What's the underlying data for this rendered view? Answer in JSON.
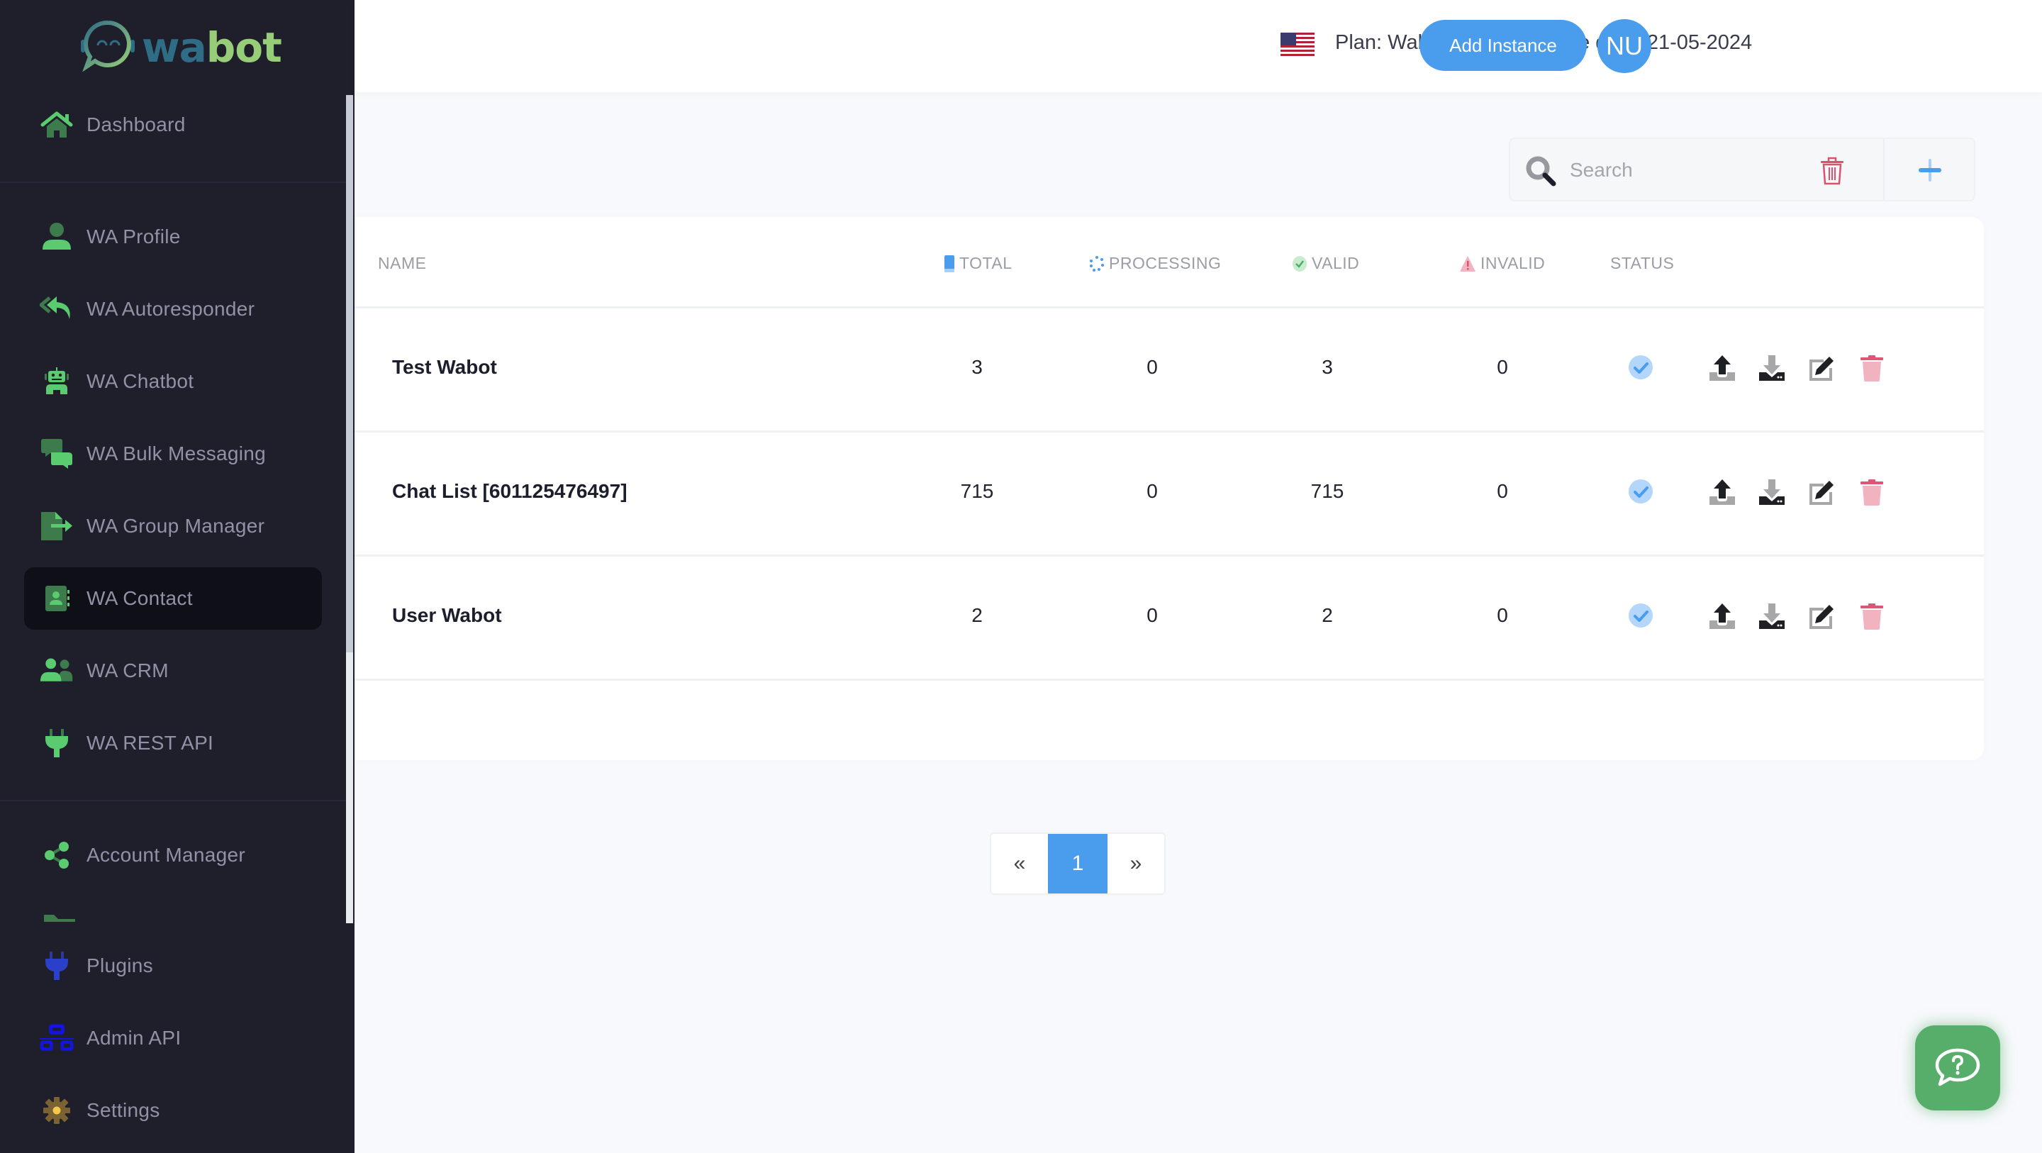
{
  "brand": {
    "logo_wa": "wa",
    "logo_bot": "bot"
  },
  "sidebar": {
    "items": [
      {
        "label": "Dashboard",
        "icon": "home-icon"
      },
      {
        "label": "WA Profile",
        "icon": "user-icon"
      },
      {
        "label": "WA Autoresponder",
        "icon": "reply-all-icon"
      },
      {
        "label": "WA Chatbot",
        "icon": "robot-icon"
      },
      {
        "label": "WA Bulk Messaging",
        "icon": "comments-icon"
      },
      {
        "label": "WA Group Manager",
        "icon": "file-export-icon"
      },
      {
        "label": "WA Contact",
        "icon": "address-book-icon",
        "active": true
      },
      {
        "label": "WA CRM",
        "icon": "users-icon"
      },
      {
        "label": "WA REST API",
        "icon": "plug-icon"
      },
      {
        "label": "Account Manager",
        "icon": "share-nodes-icon"
      },
      {
        "label": "Plugins",
        "icon": "plug-icon"
      },
      {
        "label": "Admin API",
        "icon": "sitemap-icon"
      },
      {
        "label": "Settings",
        "icon": "gear-icon"
      }
    ]
  },
  "header": {
    "flag": "us-flag-icon",
    "plan": "Plan: Wabot Plus",
    "expire": "Expire date: 21-05-2024",
    "add_instance": "Add Instance",
    "avatar_initials": "NU"
  },
  "toolbar": {
    "search_placeholder": "Search",
    "search_value": ""
  },
  "table": {
    "columns": {
      "name": "NAME",
      "total": "TOTAL",
      "processing": "PROCESSING",
      "valid": "VALID",
      "invalid": "INVALID",
      "status": "STATUS"
    },
    "rows": [
      {
        "name": "Test Wabot",
        "total": "3",
        "processing": "0",
        "valid": "3",
        "invalid": "0",
        "status": "active"
      },
      {
        "name": "Chat List [601125476497]",
        "total": "715",
        "processing": "0",
        "valid": "715",
        "invalid": "0",
        "status": "active"
      },
      {
        "name": "User Wabot",
        "total": "2",
        "processing": "0",
        "valid": "2",
        "invalid": "0",
        "status": "active"
      }
    ]
  },
  "pagination": {
    "prev": "«",
    "current": "1",
    "next": "»"
  },
  "colors": {
    "accent": "#4a9ced",
    "sidebar_bg": "#1f1f2c",
    "green": "#5acb6e",
    "danger": "#e05576",
    "fab": "#57ae6b"
  }
}
